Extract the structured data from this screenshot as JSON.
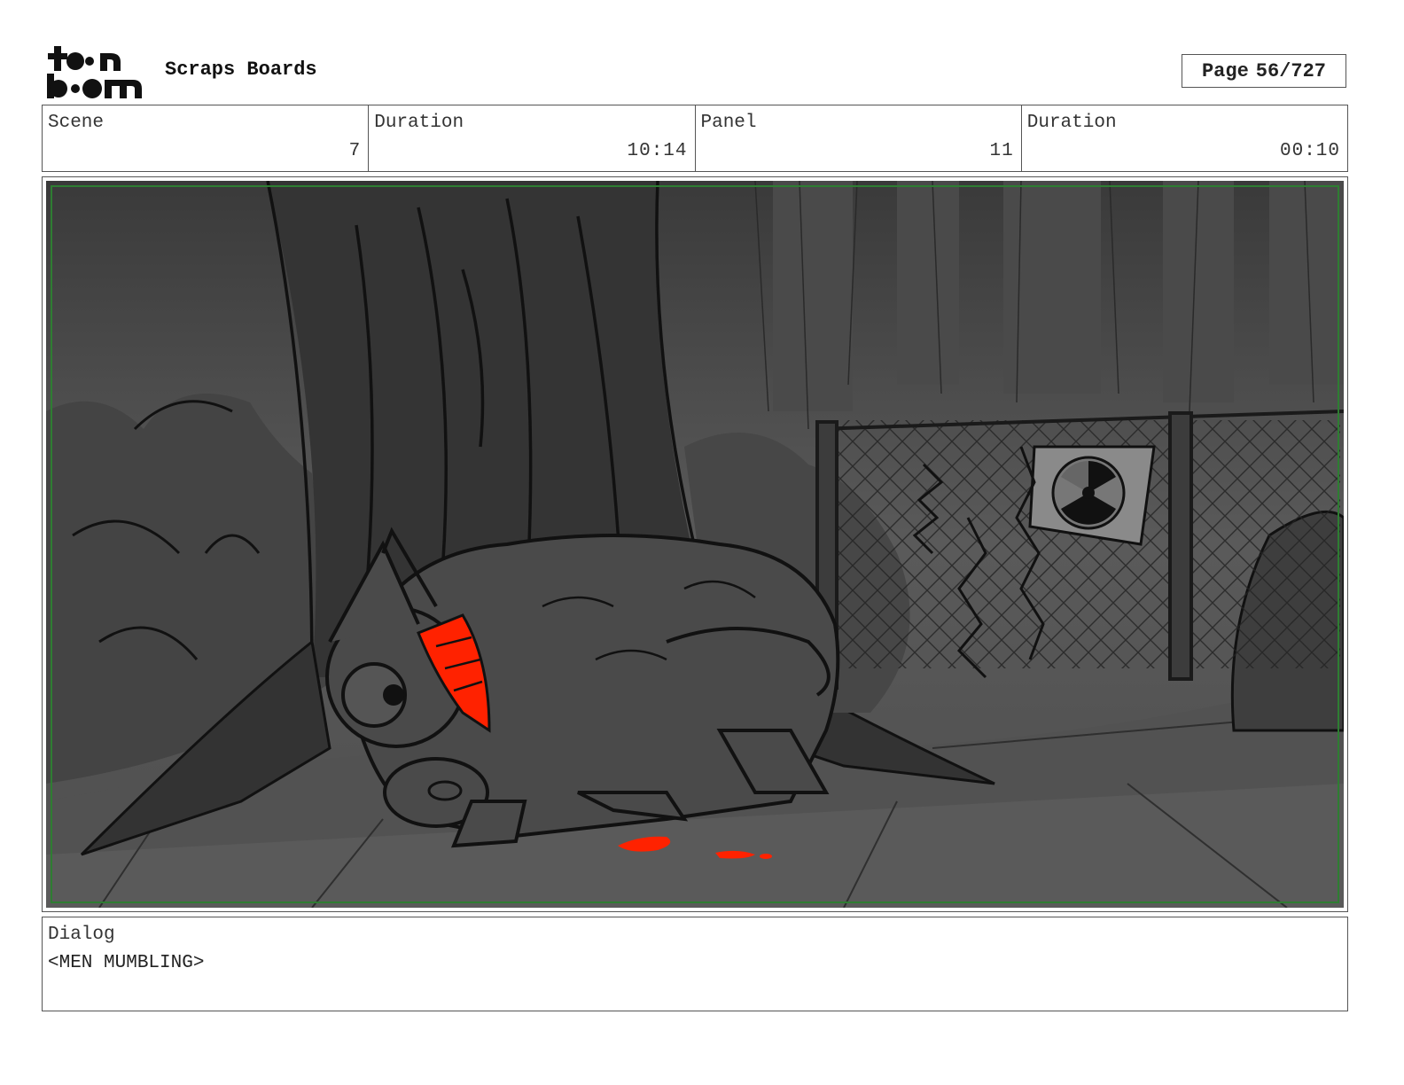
{
  "header": {
    "logo_text": "toon boom",
    "project_title": "Scraps Boards",
    "page_label": "Page",
    "page_number": "56/727"
  },
  "info": {
    "scene_label": "Scene",
    "scene_value": "7",
    "scene_duration_label": "Duration",
    "scene_duration_value": "10:14",
    "panel_label": "Panel",
    "panel_value": "11",
    "panel_duration_label": "Duration",
    "panel_duration_value": "00:10"
  },
  "panel": {
    "accent_color": "#ff2200",
    "safe_frame_color": "#2e7d32"
  },
  "dialog": {
    "label": "Dialog",
    "text": "<MEN MUMBLING>"
  }
}
